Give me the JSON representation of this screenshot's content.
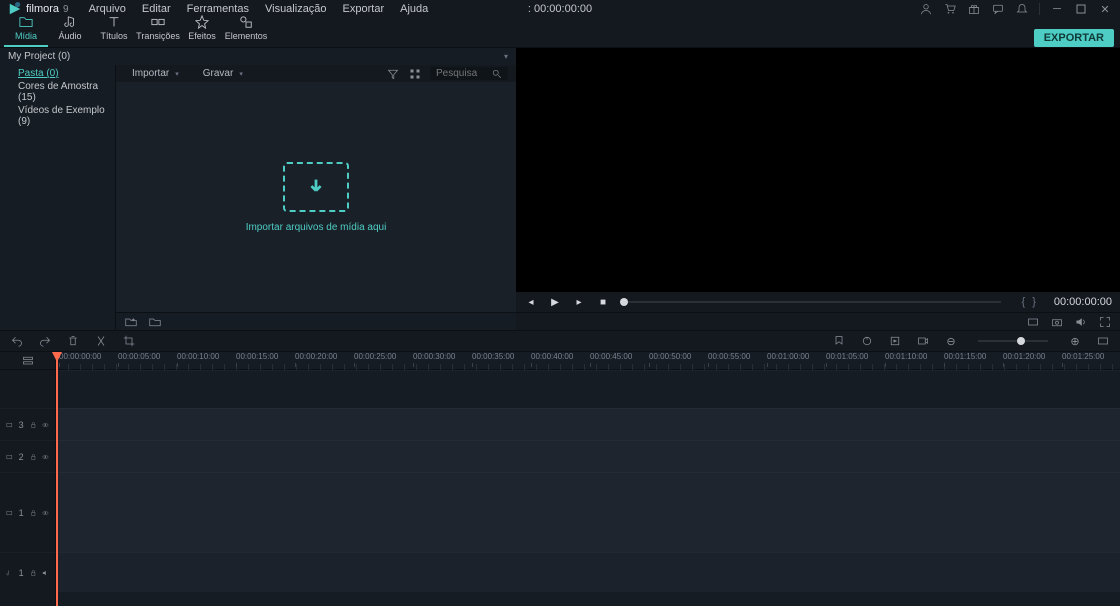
{
  "brand": {
    "name": "filmora",
    "version": "9"
  },
  "menus": [
    "Arquivo",
    "Editar",
    "Ferramentas",
    "Visualização",
    "Exportar",
    "Ajuda"
  ],
  "top_timecode": ": 00:00:00:00",
  "tabs": [
    {
      "label": "Mídia",
      "active": true
    },
    {
      "label": "Áudio"
    },
    {
      "label": "Títulos"
    },
    {
      "label": "Transições"
    },
    {
      "label": "Efeitos"
    },
    {
      "label": "Elementos"
    }
  ],
  "export_label": "EXPORTAR",
  "project": {
    "name": "My Project (0)",
    "tree": [
      {
        "label": "Pasta (0)",
        "selected": true
      },
      {
        "label": "Cores de Amostra (15)"
      },
      {
        "label": "Vídeos de Exemplo (9)"
      }
    ]
  },
  "media_toolbar": {
    "import": "Importar",
    "record": "Gravar",
    "search_placeholder": "Pesquisa"
  },
  "drop_text": "Importar arquivos de mídia aqui",
  "player_time": "00:00:00:00",
  "ruler": [
    "00:00:00:00",
    "00:00:05:00",
    "00:00:10:00",
    "00:00:15:00",
    "00:00:20:00",
    "00:00:25:00",
    "00:00:30:00",
    "00:00:35:00",
    "00:00:40:00",
    "00:00:45:00",
    "00:00:50:00",
    "00:00:55:00",
    "00:01:00:00",
    "00:01:05:00",
    "00:01:10:00",
    "00:01:15:00",
    "00:01:20:00",
    "00:01:25:00"
  ],
  "tracks": {
    "video": [
      "3",
      "2",
      "1"
    ],
    "audio": [
      "1"
    ]
  }
}
